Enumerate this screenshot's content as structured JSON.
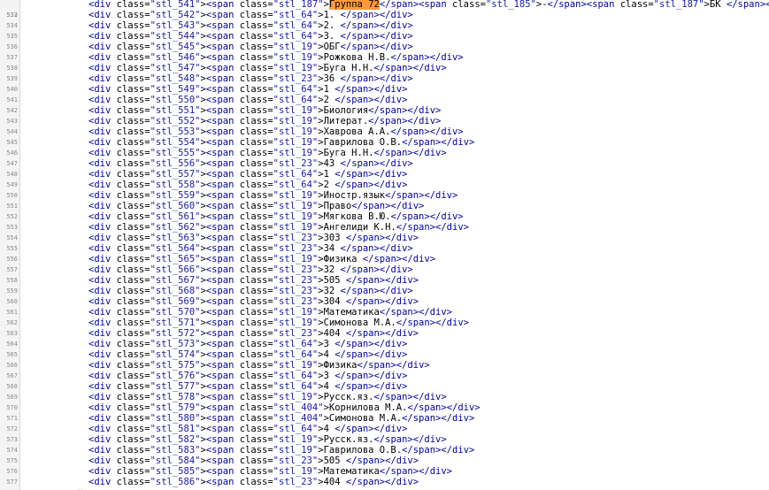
{
  "editor": {
    "lines": [
      {
        "number": "533",
        "cls": "stl_542",
        "spans": [
          {
            "cls": "stl_64",
            "text": "1. "
          }
        ]
      },
      {
        "number": "534",
        "cls": "stl_543",
        "spans": [
          {
            "cls": "stl_64",
            "text": "2. "
          }
        ]
      },
      {
        "number": "535",
        "cls": "stl_544",
        "spans": [
          {
            "cls": "stl_64",
            "text": "3. "
          }
        ]
      },
      {
        "number": "536",
        "cls": "stl_545",
        "spans": [
          {
            "cls": "stl_19",
            "text": "ОБГ"
          }
        ]
      },
      {
        "number": "537",
        "cls": "stl_546",
        "spans": [
          {
            "cls": "stl_19",
            "text": "Рожкова Н.В."
          }
        ]
      },
      {
        "number": "538",
        "cls": "stl_547",
        "spans": [
          {
            "cls": "stl_19",
            "text": "Буга Н.Н."
          }
        ]
      },
      {
        "number": "539",
        "cls": "stl_548",
        "spans": [
          {
            "cls": "stl_23",
            "text": "36 "
          }
        ]
      },
      {
        "number": "540",
        "cls": "stl_549",
        "spans": [
          {
            "cls": "stl_64",
            "text": "1 "
          }
        ]
      },
      {
        "number": "541",
        "cls": "stl_550",
        "spans": [
          {
            "cls": "stl_64",
            "text": "2 "
          }
        ]
      },
      {
        "number": "542",
        "cls": "stl_551",
        "spans": [
          {
            "cls": "stl_19",
            "text": "Биология"
          }
        ]
      },
      {
        "number": "543",
        "cls": "stl_552",
        "spans": [
          {
            "cls": "stl_19",
            "text": "Литерат."
          }
        ]
      },
      {
        "number": "544",
        "cls": "stl_553",
        "spans": [
          {
            "cls": "stl_19",
            "text": "Хаврова А.А."
          }
        ]
      },
      {
        "number": "545",
        "cls": "stl_554",
        "spans": [
          {
            "cls": "stl_19",
            "text": "Гаврилова О.В."
          }
        ]
      },
      {
        "number": "546",
        "cls": "stl_555",
        "spans": [
          {
            "cls": "stl_19",
            "text": "Буга Н.Н."
          }
        ]
      },
      {
        "number": "547",
        "cls": "stl_556",
        "spans": [
          {
            "cls": "stl_23",
            "text": "43 "
          }
        ]
      },
      {
        "number": "548",
        "cls": "stl_557",
        "spans": [
          {
            "cls": "stl_64",
            "text": "1 "
          }
        ]
      },
      {
        "number": "549",
        "cls": "stl_558",
        "spans": [
          {
            "cls": "stl_64",
            "text": "2 "
          }
        ]
      },
      {
        "number": "550",
        "cls": "stl_559",
        "spans": [
          {
            "cls": "stl_19",
            "text": "Иностр.язык"
          }
        ]
      },
      {
        "number": "551",
        "cls": "stl_560",
        "spans": [
          {
            "cls": "stl_19",
            "text": "Право"
          }
        ]
      },
      {
        "number": "552",
        "cls": "stl_561",
        "spans": [
          {
            "cls": "stl_19",
            "text": "Мягкова В.Ю."
          }
        ]
      },
      {
        "number": "553",
        "cls": "stl_562",
        "spans": [
          {
            "cls": "stl_19",
            "text": "Ангелиди К.Н."
          }
        ]
      },
      {
        "number": "554",
        "cls": "stl_563",
        "spans": [
          {
            "cls": "stl_23",
            "text": "303 "
          }
        ]
      },
      {
        "number": "555",
        "cls": "stl_564",
        "spans": [
          {
            "cls": "stl_23",
            "text": "34 "
          }
        ]
      },
      {
        "number": "556",
        "cls": "stl_565",
        "spans": [
          {
            "cls": "stl_19",
            "text": "Физика "
          }
        ]
      },
      {
        "number": "557",
        "cls": "stl_566",
        "spans": [
          {
            "cls": "stl_23",
            "text": "32 "
          }
        ]
      },
      {
        "number": "558",
        "cls": "stl_567",
        "spans": [
          {
            "cls": "stl_23",
            "text": "505 "
          }
        ]
      },
      {
        "number": "559",
        "cls": "stl_568",
        "spans": [
          {
            "cls": "stl_23",
            "text": "32 "
          }
        ]
      },
      {
        "number": "560",
        "cls": "stl_569",
        "spans": [
          {
            "cls": "stl_23",
            "text": "304 "
          }
        ]
      },
      {
        "number": "561",
        "cls": "stl_570",
        "spans": [
          {
            "cls": "stl_19",
            "text": "Математика"
          }
        ]
      },
      {
        "number": "562",
        "cls": "stl_571",
        "spans": [
          {
            "cls": "stl_19",
            "text": "Симонова М.А."
          }
        ]
      },
      {
        "number": "563",
        "cls": "stl_572",
        "spans": [
          {
            "cls": "stl_23",
            "text": "404 "
          }
        ]
      },
      {
        "number": "564",
        "cls": "stl_573",
        "spans": [
          {
            "cls": "stl_64",
            "text": "3 "
          }
        ]
      },
      {
        "number": "565",
        "cls": "stl_574",
        "spans": [
          {
            "cls": "stl_64",
            "text": "4 "
          }
        ]
      },
      {
        "number": "566",
        "cls": "stl_575",
        "spans": [
          {
            "cls": "stl_19",
            "text": "Физика"
          }
        ]
      },
      {
        "number": "567",
        "cls": "stl_576",
        "spans": [
          {
            "cls": "stl_64",
            "text": "3 "
          }
        ]
      },
      {
        "number": "568",
        "cls": "stl_577",
        "spans": [
          {
            "cls": "stl_64",
            "text": "4 "
          }
        ]
      },
      {
        "number": "569",
        "cls": "stl_578",
        "spans": [
          {
            "cls": "stl_19",
            "text": "Русск.яз."
          }
        ]
      },
      {
        "number": "570",
        "cls": "stl_579",
        "spans": [
          {
            "cls": "stl_404",
            "text": "Корнилова М.А."
          }
        ]
      },
      {
        "number": "571",
        "cls": "stl_580",
        "spans": [
          {
            "cls": "stl_404",
            "text": "Симонова М.А."
          }
        ]
      },
      {
        "number": "572",
        "cls": "stl_581",
        "spans": [
          {
            "cls": "stl_64",
            "text": "4 "
          }
        ]
      },
      {
        "number": "573",
        "cls": "stl_582",
        "spans": [
          {
            "cls": "stl_19",
            "text": "Русск.яз."
          }
        ]
      },
      {
        "number": "574",
        "cls": "stl_583",
        "spans": [
          {
            "cls": "stl_19",
            "text": "Гаврилова О.В."
          }
        ]
      },
      {
        "number": "575",
        "cls": "stl_584",
        "spans": [
          {
            "cls": "stl_23",
            "text": "505 "
          }
        ]
      },
      {
        "number": "576",
        "cls": "stl_585",
        "spans": [
          {
            "cls": "stl_19",
            "text": "Математика"
          }
        ]
      },
      {
        "number": "577",
        "cls": "stl_586",
        "spans": [
          {
            "cls": "stl_23",
            "text": "404 "
          }
        ]
      }
    ],
    "first_line": {
      "number": "532",
      "div_cls": "stl_541",
      "s1_cls": "stl_187",
      "s1_text": "Группа 72",
      "dash": "-",
      "s2_cls": "stl_185",
      "s3_cls": "stl_187",
      "s3_text": "БК "
    },
    "fold_marker": "…"
  }
}
